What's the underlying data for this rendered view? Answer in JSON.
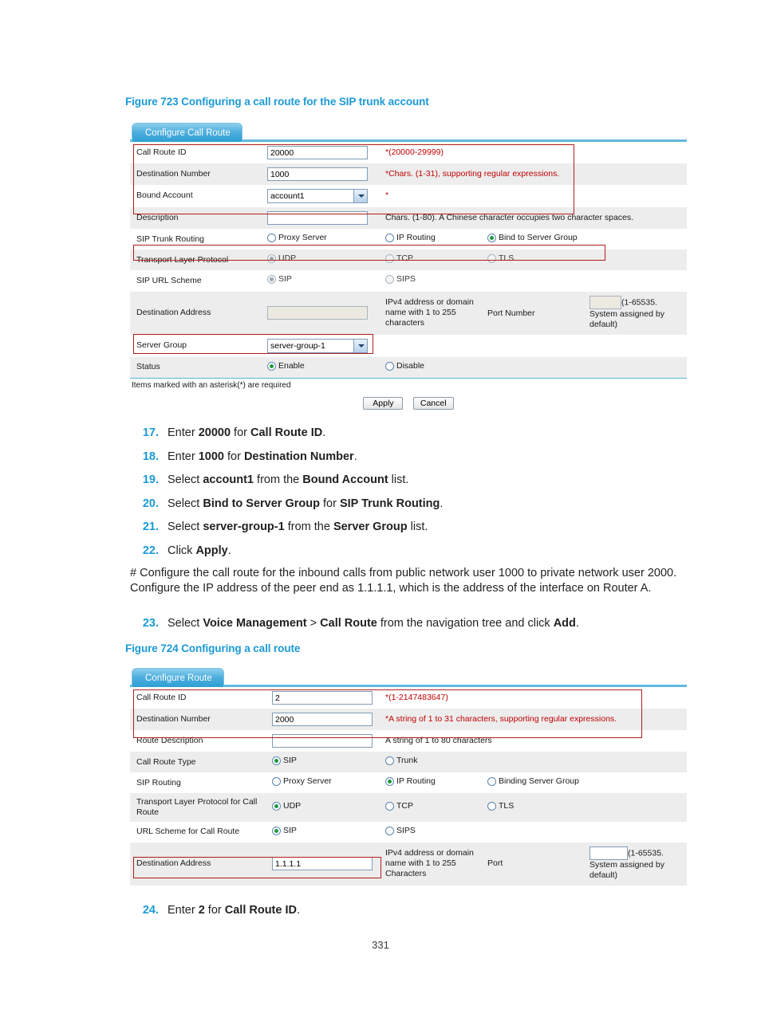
{
  "figure723": {
    "caption": "Figure 723 Configuring a call route for the SIP trunk account",
    "tab_label": "Configure Call Route",
    "rows": {
      "call_route_id_label": "Call Route ID",
      "call_route_id_value": "20000",
      "call_route_id_hint": "*(20000-29999)",
      "destination_number_label": "Destination Number",
      "destination_number_value": "1000",
      "destination_number_hint": "*Chars. (1-31), supporting regular expressions.",
      "bound_account_label": "Bound Account",
      "bound_account_value": "account1",
      "bound_account_hint": "*",
      "description_label": "Description",
      "description_value": "",
      "description_hint": "Chars. (1-80). A Chinese character occupies two character spaces.",
      "sip_trunk_routing_label": "SIP Trunk Routing",
      "sip_trunk_routing_opt1": "Proxy Server",
      "sip_trunk_routing_opt2": "IP Routing",
      "sip_trunk_routing_opt3": "Bind to Server Group",
      "transport_label": "Transport Layer Protocol",
      "transport_opt1": "UDP",
      "transport_opt2": "TCP",
      "transport_opt3": "TLS",
      "url_scheme_label": "SIP URL Scheme",
      "url_scheme_opt1": "SIP",
      "url_scheme_opt2": "SIPS",
      "destination_address_label": "Destination Address",
      "destination_address_value": "",
      "destination_address_hint": "IPv4 address or domain name with 1 to 255 characters",
      "port_number_label": "Port Number",
      "port_number_value": "",
      "port_number_hint": "(1-65535. System assigned by default)",
      "server_group_label": "Server Group",
      "server_group_value": "server-group-1",
      "status_label": "Status",
      "status_opt1": "Enable",
      "status_opt2": "Disable"
    },
    "footnote": "Items marked with an asterisk(*) are required",
    "apply_label": "Apply",
    "cancel_label": "Cancel"
  },
  "steps_group_a": [
    {
      "num": "17.",
      "html": "Enter <b>20000</b> for <b>Call Route ID</b>."
    },
    {
      "num": "18.",
      "html": "Enter <b>1000</b> for <b>Destination Number</b>."
    },
    {
      "num": "19.",
      "html": "Select <b>account1</b> from the <b>Bound Account</b> list."
    },
    {
      "num": "20.",
      "html": "Select <b>Bind to Server Group</b> for <b>SIP Trunk Routing</b>."
    },
    {
      "num": "21.",
      "html": "Select <b>server-group-1</b> from the <b>Server Group</b> list."
    },
    {
      "num": "22.",
      "html": "Click <b>Apply</b>."
    }
  ],
  "paragraph": "# Configure the call route for the inbound calls from public network user 1000 to private network user 2000. Configure the IP address of the peer end as 1.1.1.1, which is the address of the interface on Router A.",
  "steps_group_b": [
    {
      "num": "23.",
      "html": "Select <b>Voice Management</b> &gt; <b>Call Route</b> from the navigation tree and click <b>Add</b>."
    }
  ],
  "figure724": {
    "caption": "Figure 724 Configuring a call route",
    "tab_label": "Configure Route",
    "rows": {
      "call_route_id_label": "Call Route ID",
      "call_route_id_value": "2",
      "call_route_id_hint": "*(1-2147483647)",
      "destination_number_label": "Destination Number",
      "destination_number_value": "2000",
      "destination_number_hint": "*A string of 1 to 31 characters, supporting regular expressions.",
      "route_description_label": "Route Description",
      "route_description_value": "",
      "route_description_hint": "A string of 1 to 80 characters",
      "call_route_type_label": "Call Route Type",
      "call_route_type_opt1": "SIP",
      "call_route_type_opt2": "Trunk",
      "sip_routing_label": "SIP Routing",
      "sip_routing_opt1": "Proxy Server",
      "sip_routing_opt2": "IP Routing",
      "sip_routing_opt3": "Binding Server Group",
      "transport_label": "Transport Layer Protocol for Call Route",
      "transport_opt1": "UDP",
      "transport_opt2": "TCP",
      "transport_opt3": "TLS",
      "url_scheme_label": "URL Scheme for Call Route",
      "url_scheme_opt1": "SIP",
      "url_scheme_opt2": "SIPS",
      "destination_address_label": "Destination Address",
      "destination_address_value": "1.1.1.1",
      "destination_address_hint": "IPv4 address or domain name with 1 to 255 Characters",
      "port_label": "Port",
      "port_value": "",
      "port_hint": "(1-65535. System assigned by default)"
    }
  },
  "steps_group_c": [
    {
      "num": "24.",
      "html": "Enter <b>2</b> for <b>Call Route ID</b>."
    }
  ],
  "page_number": "331",
  "colors": {
    "accent_blue": "#1b9ad6",
    "tab_blue": "#2e9fd4",
    "highlight_red": "#b11d1d",
    "row_gray": "#ededed",
    "radio_green": "#1f9a3d"
  }
}
